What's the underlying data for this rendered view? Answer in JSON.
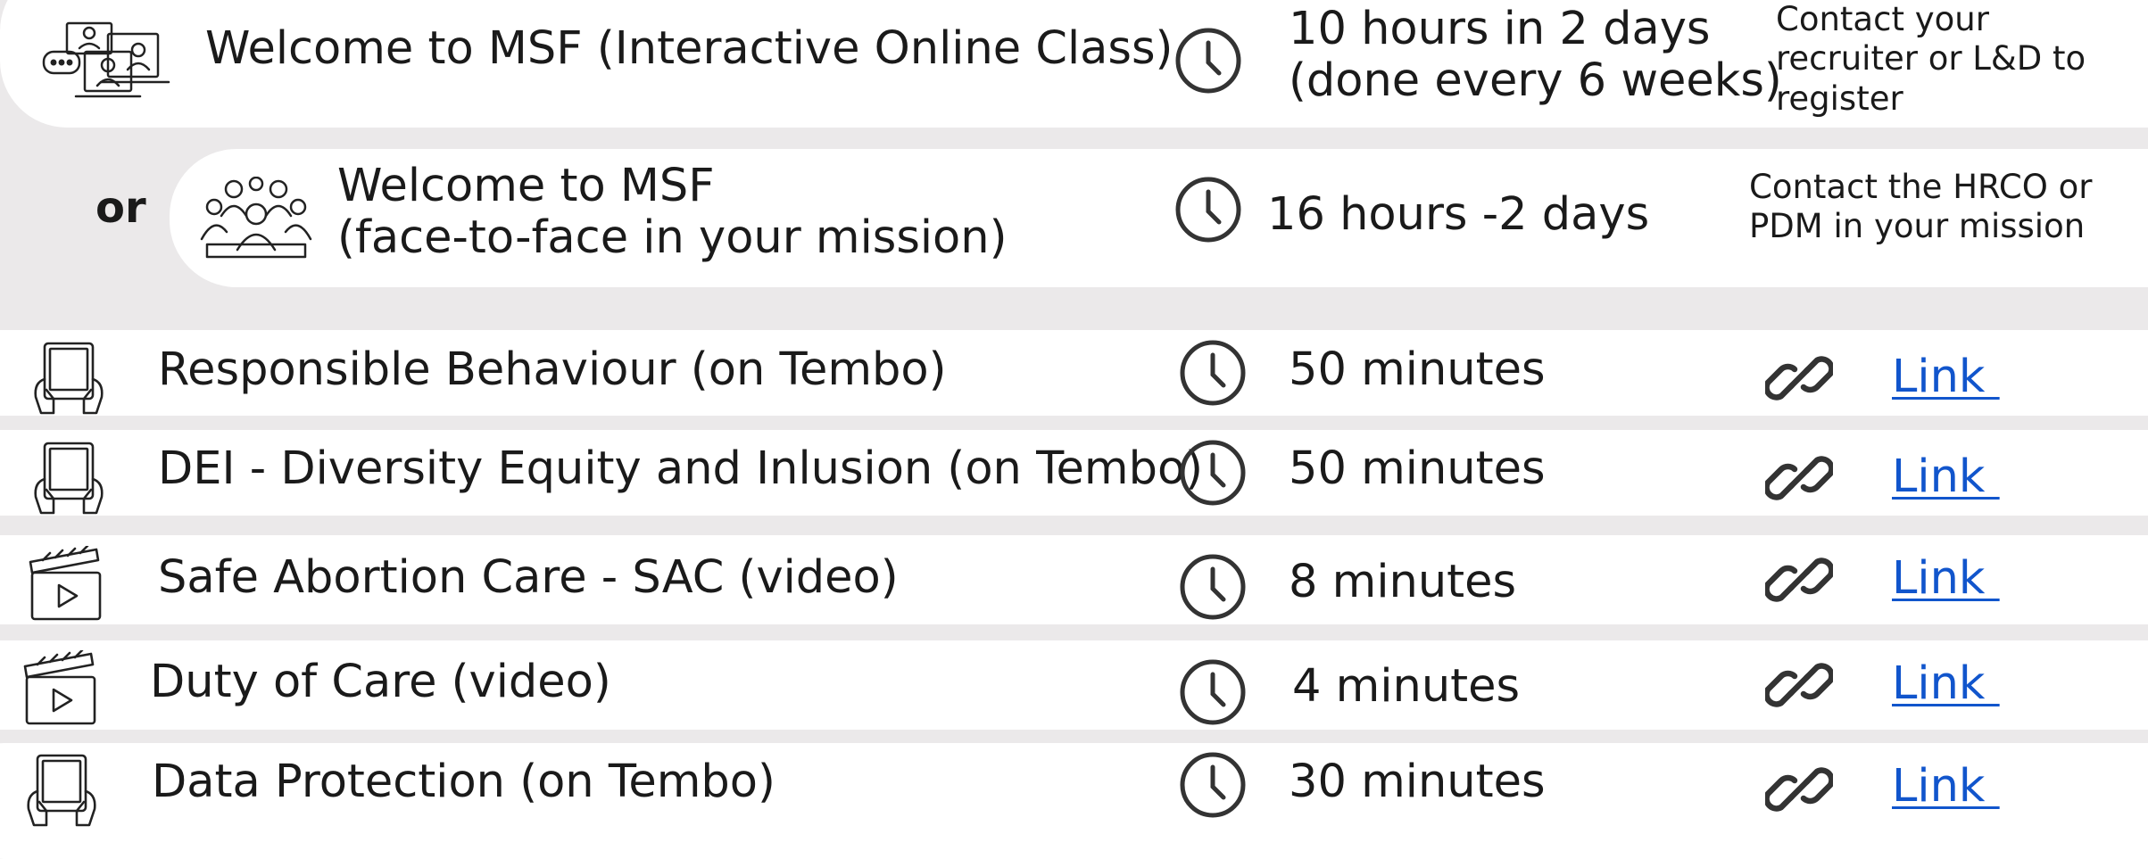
{
  "or_label": "or",
  "featured": [
    {
      "icon": "online-class-icon",
      "title_lines": [
        "Welcome to MSF (Interactive Online Class)"
      ],
      "duration_lines": [
        "10 hours in 2 days",
        "(done every 6 weeks)"
      ],
      "contact_lines": [
        "Contact your",
        "recruiter or L&D to",
        "register"
      ]
    },
    {
      "icon": "group-icon",
      "title_lines": [
        "Welcome to MSF",
        "(face-to-face in your mission)"
      ],
      "duration_lines": [
        "16 hours -2 days"
      ],
      "contact_lines": [
        "Contact the HRCO or",
        "PDM in your mission"
      ]
    }
  ],
  "courses": [
    {
      "icon": "tablet-icon",
      "title": "Responsible Behaviour (on Tembo)",
      "duration": "50 minutes",
      "link": "Link "
    },
    {
      "icon": "tablet-icon",
      "title": "DEI - Diversity Equity and Inlusion (on Tembo)",
      "duration": "50 minutes",
      "link": "Link "
    },
    {
      "icon": "clapperboard-icon",
      "title": "Safe Abortion Care - SAC (video)",
      "duration": "8 minutes",
      "link": "Link "
    },
    {
      "icon": "clapperboard-icon",
      "title": "Duty of Care (video)",
      "duration": "4 minutes",
      "link": "Link "
    },
    {
      "icon": "tablet-icon",
      "title": "Data Protection (on Tembo)",
      "duration": "30 minutes",
      "link": "Link "
    }
  ]
}
